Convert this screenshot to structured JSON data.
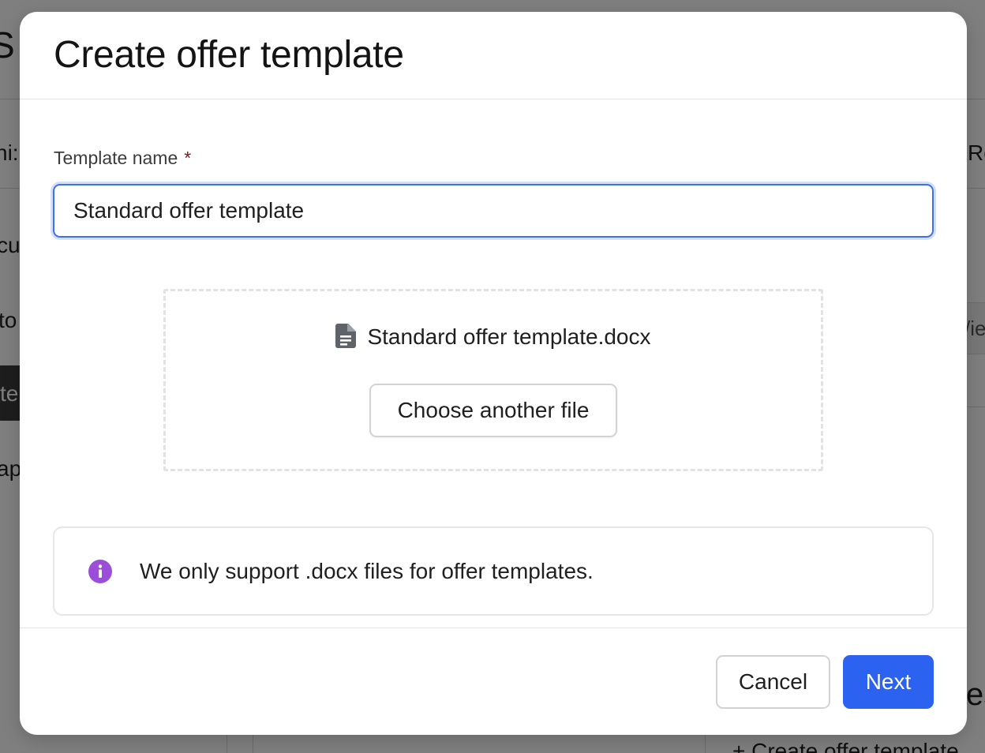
{
  "background": {
    "fragments": {
      "heading": "S",
      "tab_left": "ni:",
      "tab_right": "Re",
      "nav_1": "cu",
      "nav_2": "to",
      "nav_3_active": "te",
      "nav_4": "ap",
      "view": "/ie",
      "section_right": "es",
      "bottom_link": "+ Create offer template"
    }
  },
  "modal": {
    "title": "Create offer template",
    "template_name": {
      "label": "Template name",
      "required_mark": "*",
      "value": "Standard offer template"
    },
    "upload": {
      "file_icon": "document-icon",
      "file_name": "Standard offer template.docx",
      "choose_button_label": "Choose another file"
    },
    "info": {
      "icon": "info-icon",
      "icon_color": "#9b4fd8",
      "message": "We only support .docx files for offer templates."
    },
    "footer": {
      "cancel_label": "Cancel",
      "next_label": "Next",
      "primary_color": "#2b63f0"
    }
  }
}
